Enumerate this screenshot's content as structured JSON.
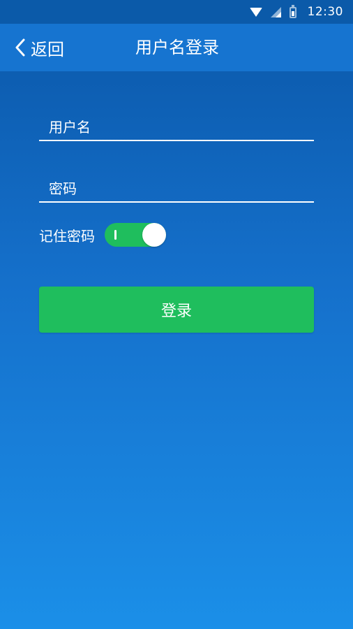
{
  "status_bar": {
    "time": "12:30",
    "icons": [
      "wifi-icon",
      "signal-icon",
      "battery-icon"
    ]
  },
  "header": {
    "back_label": "返回",
    "title": "用户名登录"
  },
  "form": {
    "username_placeholder": "用户名",
    "username_value": "",
    "password_placeholder": "密码",
    "password_value": "",
    "remember_label": "记住密码",
    "remember_enabled": true,
    "login_label": "登录"
  },
  "colors": {
    "primary_blue": "#1674d0",
    "status_bar_blue": "#0b5aa9",
    "accent_green": "#1fbe5d",
    "text": "#ffffff"
  }
}
